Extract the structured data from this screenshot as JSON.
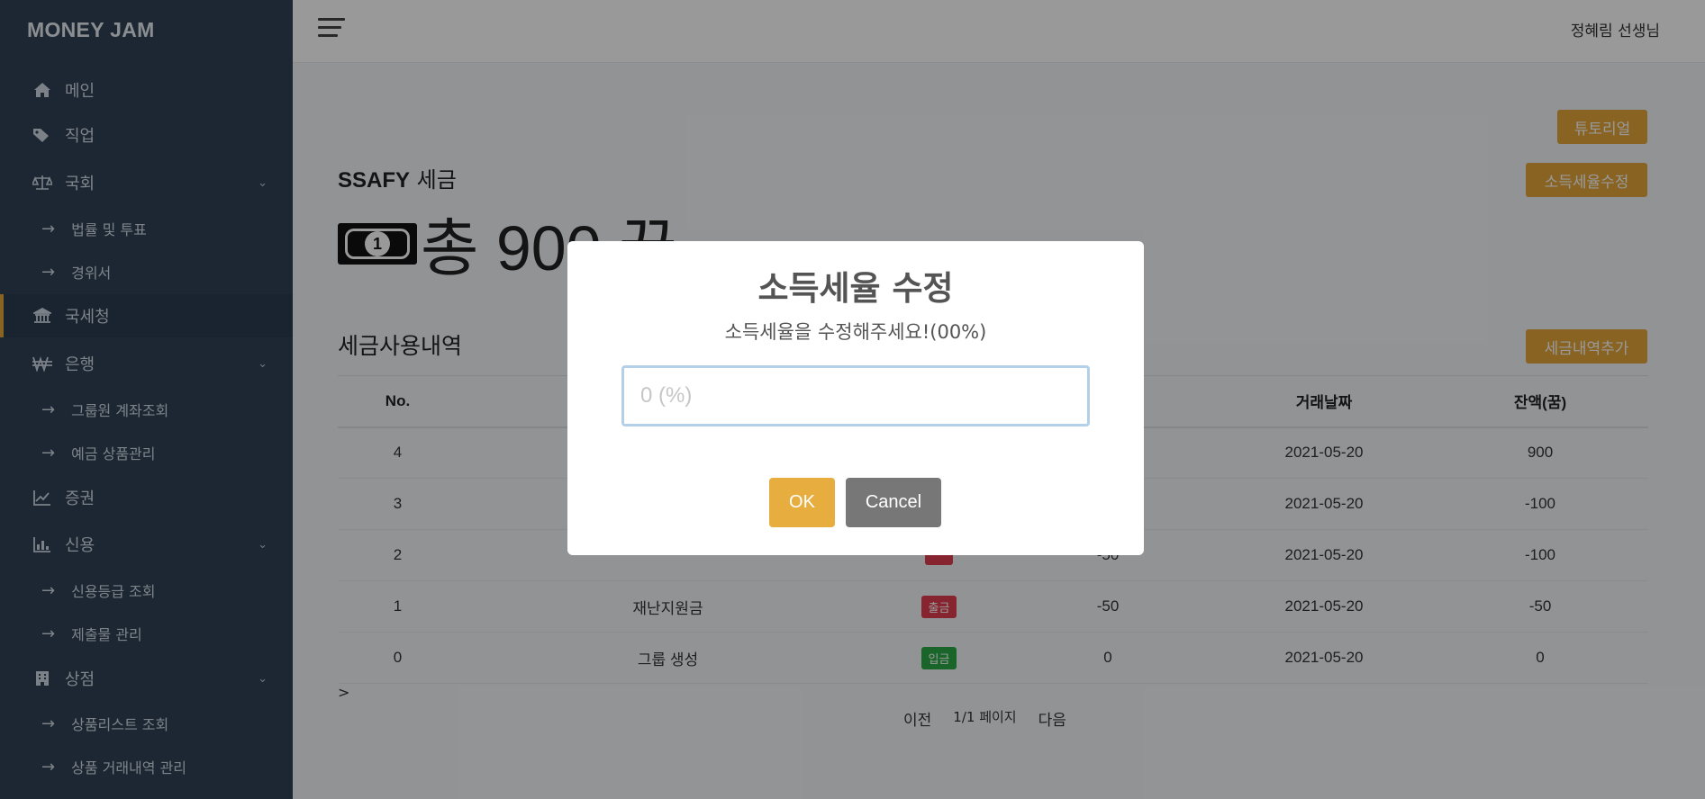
{
  "brand": "MONEY JAM",
  "sidebar": {
    "items": [
      {
        "label": "메인",
        "icon": "home-icon"
      },
      {
        "label": "직업",
        "icon": "tags-icon"
      },
      {
        "label": "국회",
        "icon": "balance-scale-icon"
      },
      {
        "label": "법률 및 투표"
      },
      {
        "label": "경위서"
      },
      {
        "label": "국세청",
        "icon": "bank-icon"
      },
      {
        "label": "은행",
        "icon": "won-icon"
      },
      {
        "label": "그룹원 계좌조회"
      },
      {
        "label": "예금 상품관리"
      },
      {
        "label": "증권",
        "icon": "line-chart-icon"
      },
      {
        "label": "신용",
        "icon": "bar-chart-icon"
      },
      {
        "label": "신용등급 조회"
      },
      {
        "label": "제출물 관리"
      },
      {
        "label": "상점",
        "icon": "building-icon"
      },
      {
        "label": "상품리스트 조회"
      },
      {
        "label": "상품 거래내역 관리"
      }
    ],
    "sub_arrow": "→",
    "chevron": "⌄"
  },
  "topbar": {
    "user": "정혜림 선생님"
  },
  "main": {
    "tutorial_btn": "튜토리얼",
    "edit_tax_btn": "소득세율수정",
    "group_name": "SSAFY",
    "tax_label": "세금",
    "total": "총 900 꿈",
    "coin_symbol": "1",
    "section_title": "세금사용내역",
    "add_btn": "세금내역추가",
    "table": {
      "headers": [
        "No.",
        "",
        "",
        "",
        "거래날짜",
        "잔액(꿈)"
      ],
      "rows": [
        {
          "no": "4",
          "desc": "",
          "type": "",
          "amount": "",
          "date": "2021-05-20",
          "balance": "900"
        },
        {
          "no": "3",
          "desc": "",
          "type": "",
          "amount": "",
          "date": "2021-05-20",
          "balance": "-100"
        },
        {
          "no": "2",
          "desc": "",
          "type": "",
          "amount": "-50",
          "date": "2021-05-20",
          "balance": "-100"
        },
        {
          "no": "1",
          "desc": "재난지원금",
          "type": "출금",
          "amount": "-50",
          "date": "2021-05-20",
          "balance": "-50"
        },
        {
          "no": "0",
          "desc": "그룹 생성",
          "type": "입금",
          "amount": "0",
          "date": "2021-05-20",
          "balance": "0"
        }
      ]
    },
    "gt": ">",
    "pager": {
      "prev": "이전",
      "page": "1/1 페이지",
      "next": "다음"
    }
  },
  "modal": {
    "title": "소득세율 수정",
    "text": "소득세율을 수정해주세요!(00%)",
    "placeholder": "0 (%)",
    "ok": "OK",
    "cancel": "Cancel"
  },
  "colors": {
    "sidebar": "#2f4155",
    "accent": "#e3a53a",
    "out": "#e03d4f",
    "in": "#2aa846"
  }
}
